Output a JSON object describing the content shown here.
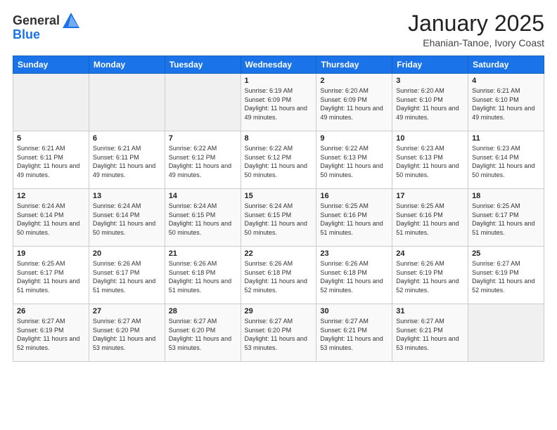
{
  "header": {
    "logo_general": "General",
    "logo_blue": "Blue",
    "title": "January 2025",
    "subtitle": "Ehanian-Tanoe, Ivory Coast"
  },
  "days_of_week": [
    "Sunday",
    "Monday",
    "Tuesday",
    "Wednesday",
    "Thursday",
    "Friday",
    "Saturday"
  ],
  "weeks": [
    [
      {
        "day": "",
        "sunrise": "",
        "sunset": "",
        "daylight": ""
      },
      {
        "day": "",
        "sunrise": "",
        "sunset": "",
        "daylight": ""
      },
      {
        "day": "",
        "sunrise": "",
        "sunset": "",
        "daylight": ""
      },
      {
        "day": "1",
        "sunrise": "Sunrise: 6:19 AM",
        "sunset": "Sunset: 6:09 PM",
        "daylight": "Daylight: 11 hours and 49 minutes."
      },
      {
        "day": "2",
        "sunrise": "Sunrise: 6:20 AM",
        "sunset": "Sunset: 6:09 PM",
        "daylight": "Daylight: 11 hours and 49 minutes."
      },
      {
        "day": "3",
        "sunrise": "Sunrise: 6:20 AM",
        "sunset": "Sunset: 6:10 PM",
        "daylight": "Daylight: 11 hours and 49 minutes."
      },
      {
        "day": "4",
        "sunrise": "Sunrise: 6:21 AM",
        "sunset": "Sunset: 6:10 PM",
        "daylight": "Daylight: 11 hours and 49 minutes."
      }
    ],
    [
      {
        "day": "5",
        "sunrise": "Sunrise: 6:21 AM",
        "sunset": "Sunset: 6:11 PM",
        "daylight": "Daylight: 11 hours and 49 minutes."
      },
      {
        "day": "6",
        "sunrise": "Sunrise: 6:21 AM",
        "sunset": "Sunset: 6:11 PM",
        "daylight": "Daylight: 11 hours and 49 minutes."
      },
      {
        "day": "7",
        "sunrise": "Sunrise: 6:22 AM",
        "sunset": "Sunset: 6:12 PM",
        "daylight": "Daylight: 11 hours and 49 minutes."
      },
      {
        "day": "8",
        "sunrise": "Sunrise: 6:22 AM",
        "sunset": "Sunset: 6:12 PM",
        "daylight": "Daylight: 11 hours and 50 minutes."
      },
      {
        "day": "9",
        "sunrise": "Sunrise: 6:22 AM",
        "sunset": "Sunset: 6:13 PM",
        "daylight": "Daylight: 11 hours and 50 minutes."
      },
      {
        "day": "10",
        "sunrise": "Sunrise: 6:23 AM",
        "sunset": "Sunset: 6:13 PM",
        "daylight": "Daylight: 11 hours and 50 minutes."
      },
      {
        "day": "11",
        "sunrise": "Sunrise: 6:23 AM",
        "sunset": "Sunset: 6:14 PM",
        "daylight": "Daylight: 11 hours and 50 minutes."
      }
    ],
    [
      {
        "day": "12",
        "sunrise": "Sunrise: 6:24 AM",
        "sunset": "Sunset: 6:14 PM",
        "daylight": "Daylight: 11 hours and 50 minutes."
      },
      {
        "day": "13",
        "sunrise": "Sunrise: 6:24 AM",
        "sunset": "Sunset: 6:14 PM",
        "daylight": "Daylight: 11 hours and 50 minutes."
      },
      {
        "day": "14",
        "sunrise": "Sunrise: 6:24 AM",
        "sunset": "Sunset: 6:15 PM",
        "daylight": "Daylight: 11 hours and 50 minutes."
      },
      {
        "day": "15",
        "sunrise": "Sunrise: 6:24 AM",
        "sunset": "Sunset: 6:15 PM",
        "daylight": "Daylight: 11 hours and 50 minutes."
      },
      {
        "day": "16",
        "sunrise": "Sunrise: 6:25 AM",
        "sunset": "Sunset: 6:16 PM",
        "daylight": "Daylight: 11 hours and 51 minutes."
      },
      {
        "day": "17",
        "sunrise": "Sunrise: 6:25 AM",
        "sunset": "Sunset: 6:16 PM",
        "daylight": "Daylight: 11 hours and 51 minutes."
      },
      {
        "day": "18",
        "sunrise": "Sunrise: 6:25 AM",
        "sunset": "Sunset: 6:17 PM",
        "daylight": "Daylight: 11 hours and 51 minutes."
      }
    ],
    [
      {
        "day": "19",
        "sunrise": "Sunrise: 6:25 AM",
        "sunset": "Sunset: 6:17 PM",
        "daylight": "Daylight: 11 hours and 51 minutes."
      },
      {
        "day": "20",
        "sunrise": "Sunrise: 6:26 AM",
        "sunset": "Sunset: 6:17 PM",
        "daylight": "Daylight: 11 hours and 51 minutes."
      },
      {
        "day": "21",
        "sunrise": "Sunrise: 6:26 AM",
        "sunset": "Sunset: 6:18 PM",
        "daylight": "Daylight: 11 hours and 51 minutes."
      },
      {
        "day": "22",
        "sunrise": "Sunrise: 6:26 AM",
        "sunset": "Sunset: 6:18 PM",
        "daylight": "Daylight: 11 hours and 52 minutes."
      },
      {
        "day": "23",
        "sunrise": "Sunrise: 6:26 AM",
        "sunset": "Sunset: 6:18 PM",
        "daylight": "Daylight: 11 hours and 52 minutes."
      },
      {
        "day": "24",
        "sunrise": "Sunrise: 6:26 AM",
        "sunset": "Sunset: 6:19 PM",
        "daylight": "Daylight: 11 hours and 52 minutes."
      },
      {
        "day": "25",
        "sunrise": "Sunrise: 6:27 AM",
        "sunset": "Sunset: 6:19 PM",
        "daylight": "Daylight: 11 hours and 52 minutes."
      }
    ],
    [
      {
        "day": "26",
        "sunrise": "Sunrise: 6:27 AM",
        "sunset": "Sunset: 6:19 PM",
        "daylight": "Daylight: 11 hours and 52 minutes."
      },
      {
        "day": "27",
        "sunrise": "Sunrise: 6:27 AM",
        "sunset": "Sunset: 6:20 PM",
        "daylight": "Daylight: 11 hours and 53 minutes."
      },
      {
        "day": "28",
        "sunrise": "Sunrise: 6:27 AM",
        "sunset": "Sunset: 6:20 PM",
        "daylight": "Daylight: 11 hours and 53 minutes."
      },
      {
        "day": "29",
        "sunrise": "Sunrise: 6:27 AM",
        "sunset": "Sunset: 6:20 PM",
        "daylight": "Daylight: 11 hours and 53 minutes."
      },
      {
        "day": "30",
        "sunrise": "Sunrise: 6:27 AM",
        "sunset": "Sunset: 6:21 PM",
        "daylight": "Daylight: 11 hours and 53 minutes."
      },
      {
        "day": "31",
        "sunrise": "Sunrise: 6:27 AM",
        "sunset": "Sunset: 6:21 PM",
        "daylight": "Daylight: 11 hours and 53 minutes."
      },
      {
        "day": "",
        "sunrise": "",
        "sunset": "",
        "daylight": ""
      }
    ]
  ]
}
